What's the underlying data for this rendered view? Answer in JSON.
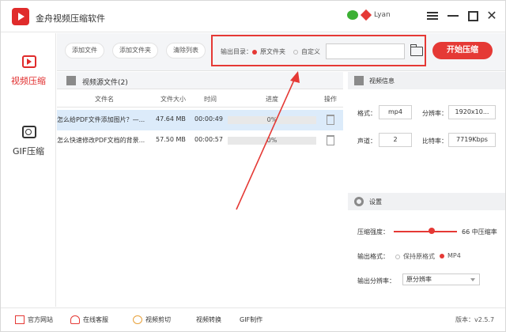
{
  "window": {
    "title": "金舟视频压缩软件",
    "username": "Lyan"
  },
  "sidebar": {
    "items": [
      {
        "label": "视频压缩"
      },
      {
        "label": "GIF压缩"
      }
    ]
  },
  "toolbar": {
    "add_file": "添加文件",
    "add_folder": "添加文件夹",
    "clear_list": "清除列表",
    "output_label": "输出目录：",
    "option_source": "原文件夹",
    "option_custom": "自定义",
    "path_value": "",
    "start": "开始压缩"
  },
  "file_list": {
    "title": "视频源文件(2)",
    "columns": [
      "文件名",
      "文件大小",
      "时间",
      "进度",
      "操作"
    ],
    "rows": [
      {
        "name": "怎么给PDF文件添加图片？—...",
        "size": "47.64 MB",
        "time": "00:00:49",
        "progress": "0%",
        "progress_value": 0
      },
      {
        "name": "怎么快速修改PDF文档的背景...",
        "size": "57.50 MB",
        "time": "00:00:57",
        "progress": "0%",
        "progress_value": 0
      }
    ]
  },
  "video_info": {
    "title": "视频信息",
    "format_label": "格式：",
    "format": "mp4",
    "resolution_label": "分辨率：",
    "resolution": "1920x10...",
    "channel_label": "声道：",
    "channel": "2",
    "bitrate_label": "比特率：",
    "bitrate": "7719Kbps"
  },
  "settings": {
    "title": "设置",
    "strength_label": "压缩强度：",
    "strength_value_text": "66 中压缩率",
    "strength_value": 66,
    "output_format_label": "输出格式：",
    "format_keep": "保持原格式",
    "format_mp4": "MP4",
    "resolution_label": "输出分辨率：",
    "resolution_value": "原分辨率"
  },
  "bottom": {
    "official_site": "官方网站",
    "online_support": "在线客服",
    "video_cut": "视频剪切",
    "video_convert": "视频转换",
    "gif_make": "GIF制作",
    "version": "版本：v2.5.7"
  },
  "colors": {
    "accent": "#e53935",
    "selected_row": "#dcebfa",
    "panel_header": "#f0f1f3"
  }
}
